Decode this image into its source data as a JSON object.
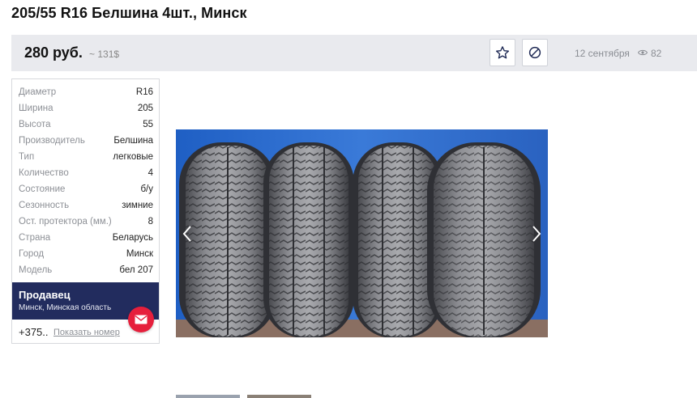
{
  "listing": {
    "title": "205/55 R16 Белшина 4шт., Минск",
    "price": "280 руб.",
    "price_usd": "~ 131$",
    "date": "12 сентября",
    "views": "82"
  },
  "specs": [
    {
      "label": "Диаметр",
      "value": "R16"
    },
    {
      "label": "Ширина",
      "value": "205"
    },
    {
      "label": "Высота",
      "value": "55"
    },
    {
      "label": "Производитель",
      "value": "Белшина"
    },
    {
      "label": "Тип",
      "value": "легковые"
    },
    {
      "label": "Количество",
      "value": "4"
    },
    {
      "label": "Состояние",
      "value": "б/у"
    },
    {
      "label": "Сезонность",
      "value": "зимние"
    },
    {
      "label": "Ост. протектора (мм.)",
      "value": "8"
    },
    {
      "label": "Страна",
      "value": "Беларусь"
    },
    {
      "label": "Город",
      "value": "Минск"
    },
    {
      "label": "Модель",
      "value": "бел 207"
    }
  ],
  "seller": {
    "title": "Продавец",
    "location": "Минск, Минская область",
    "phone": "+375..",
    "show_phone": "Показать номер"
  },
  "icons": {
    "favorite": "star-icon",
    "block": "block-icon",
    "views": "eye-icon",
    "mail": "envelope-icon",
    "prev": "chevron-left-icon",
    "next": "chevron-right-icon"
  },
  "colors": {
    "seller_bg": "#222c5e",
    "mail_button": "#e61f3c",
    "price_bar": "#e9eaee"
  }
}
